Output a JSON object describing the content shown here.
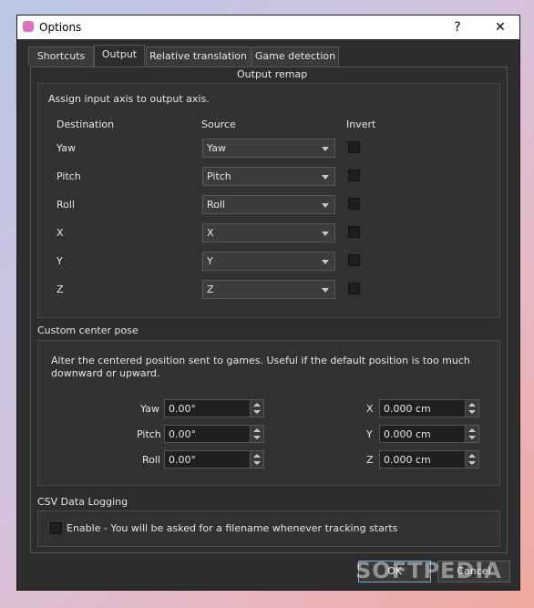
{
  "window": {
    "title": "Options",
    "help_icon": "?",
    "close_icon": "✕"
  },
  "tabs": [
    {
      "label": "Shortcuts",
      "active": false
    },
    {
      "label": "Output",
      "active": true
    },
    {
      "label": "Relative translation",
      "active": false
    },
    {
      "label": "Game detection",
      "active": false
    }
  ],
  "output_remap": {
    "title": "Output remap",
    "description": "Assign input axis to output axis.",
    "headers": {
      "destination": "Destination",
      "source": "Source",
      "invert": "Invert"
    },
    "rows": [
      {
        "destination": "Yaw",
        "source": "Yaw",
        "invert": false
      },
      {
        "destination": "Pitch",
        "source": "Pitch",
        "invert": false
      },
      {
        "destination": "Roll",
        "source": "Roll",
        "invert": false
      },
      {
        "destination": "X",
        "source": "X",
        "invert": false
      },
      {
        "destination": "Y",
        "source": "Y",
        "invert": false
      },
      {
        "destination": "Z",
        "source": "Z",
        "invert": false
      }
    ]
  },
  "center_pose": {
    "title": "Custom center pose",
    "description": "Alter the centered position sent to games. Useful if the default position is too much downward or upward.",
    "rotation": [
      {
        "label": "Yaw",
        "value": "0.00°"
      },
      {
        "label": "Pitch",
        "value": "0.00°"
      },
      {
        "label": "Roll",
        "value": "0.00°"
      }
    ],
    "position": [
      {
        "label": "X",
        "value": "0.000 cm"
      },
      {
        "label": "Y",
        "value": "0.000 cm"
      },
      {
        "label": "Z",
        "value": "0.000 cm"
      }
    ]
  },
  "csv_logging": {
    "title": "CSV Data Logging",
    "enable_label": "Enable - You will be asked for a filename whenever tracking starts",
    "enabled": false
  },
  "buttons": {
    "ok": "OK",
    "cancel": "Cancel"
  },
  "watermark": "SOFTPEDIA"
}
